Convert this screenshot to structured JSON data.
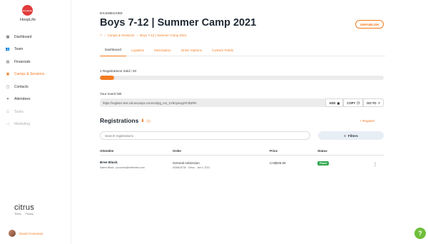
{
  "brand": {
    "logo_text": "HoopLife",
    "name": "HoopLife"
  },
  "sidebar": {
    "items": [
      {
        "label": "Dashboard",
        "icon": "grid-icon",
        "state": "normal"
      },
      {
        "label": "Team",
        "icon": "team-icon",
        "state": "normal"
      },
      {
        "label": "Financials",
        "icon": "document-icon",
        "state": "normal"
      },
      {
        "label": "Camps & Sessions",
        "icon": "calendar-icon",
        "state": "active"
      },
      {
        "label": "Contacts",
        "icon": "contacts-icon",
        "state": "normal"
      },
      {
        "label": "Attendees",
        "icon": "attendee-icon",
        "state": "normal"
      },
      {
        "label": "Tasks",
        "icon": "tasks-icon",
        "state": "muted"
      },
      {
        "label": "Marketing",
        "icon": "megaphone-icon",
        "state": "muted"
      }
    ],
    "footer_brand": "citrus",
    "legal": {
      "terms": "Terms",
      "privacy": "Privacy"
    },
    "user": {
      "name": "David Crossman"
    }
  },
  "header": {
    "kicker": "DASHBOARD",
    "title": "Boys 7-12 | Summer Camp 2021",
    "unpublish_label": "UNPUBLISH",
    "breadcrumb": {
      "home_icon": "home-icon",
      "section": "Camps & Sessions",
      "current": "Boys 7-12 | Summer Camp 2021"
    }
  },
  "tabs": [
    {
      "label": "Dashboard",
      "active": true
    },
    {
      "label": "Logistics",
      "active": false
    },
    {
      "label": "Description",
      "active": false
    },
    {
      "label": "Order Options",
      "active": false
    },
    {
      "label": "Custom Fields",
      "active": false
    }
  ],
  "registrations_sold": {
    "label": "1 Registrations Sold / 20",
    "sold": 1,
    "total": 20
  },
  "event_link": {
    "label": "Your event link",
    "url": "https://register-test.citruscamps.com/evt/pg_evt_1V9CpeogXPJb3Pkr",
    "add_label": "ADD",
    "copy_label": "COPY",
    "goto_label": "GO TO"
  },
  "registrations": {
    "title": "Registrations",
    "count": "(1)",
    "register_label": "+ Register",
    "search_placeholder": "Search registrations",
    "filters_label": "Filters",
    "columns": [
      "Attendee",
      "Order",
      "Price",
      "Status"
    ],
    "rows": [
      {
        "attendee_name": "Bree Black",
        "attendee_sub": "Salem Black · jucourms@methrator.com",
        "order_main": "General Admission",
        "order_sub": "#3368-8735 · Citrus · Jan 4, 2021",
        "price": "CA$525.00",
        "status": "Placed"
      }
    ]
  },
  "colors": {
    "accent": "#f47b20",
    "status_green": "#2fa84f",
    "help_green": "#6fbf3a"
  }
}
